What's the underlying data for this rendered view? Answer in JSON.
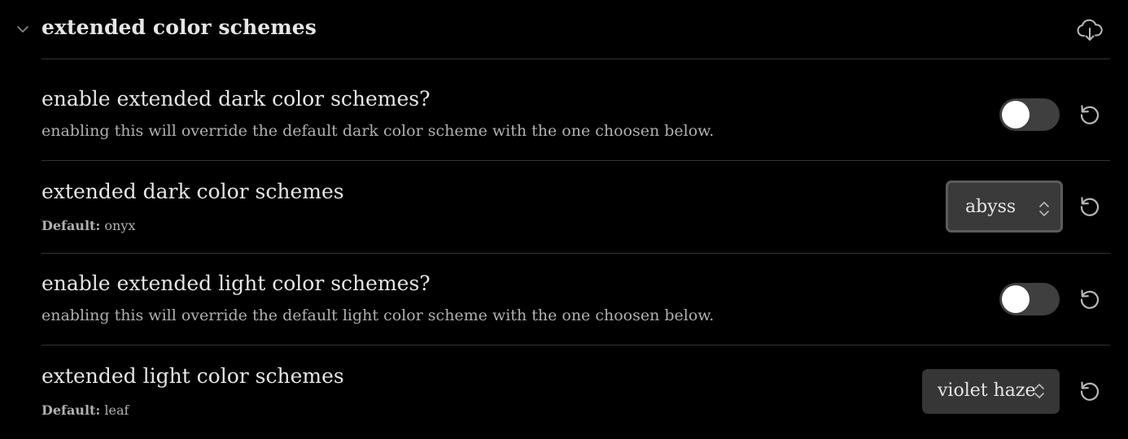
{
  "section": {
    "title": "extended color schemes",
    "collapse_icon": "chevron-down-icon",
    "action_icon": "download-cloud-icon"
  },
  "settings": [
    {
      "name": "enable extended dark color schemes?",
      "description": "enabling this will override the default dark color scheme with the one choosen below.",
      "control": "toggle",
      "enabled": false,
      "reset_icon": "reset-icon"
    },
    {
      "name": "extended dark color schemes",
      "default_label": "Default:",
      "default_value": "onyx",
      "control": "dropdown",
      "selected": "abyss",
      "reset_icon": "reset-icon"
    },
    {
      "name": "enable extended light color schemes?",
      "description": "enabling this will override the default light color scheme with the one choosen below.",
      "control": "toggle",
      "enabled": false,
      "reset_icon": "reset-icon"
    },
    {
      "name": "extended light color schemes",
      "default_label": "Default:",
      "default_value": "leaf",
      "control": "dropdown",
      "selected": "violet haze",
      "reset_icon": "reset-icon"
    }
  ],
  "colors": {
    "background": "#000000",
    "divider": "#333333",
    "toggle_off": "#3f3f3f",
    "dropdown_bg": "#363636"
  }
}
